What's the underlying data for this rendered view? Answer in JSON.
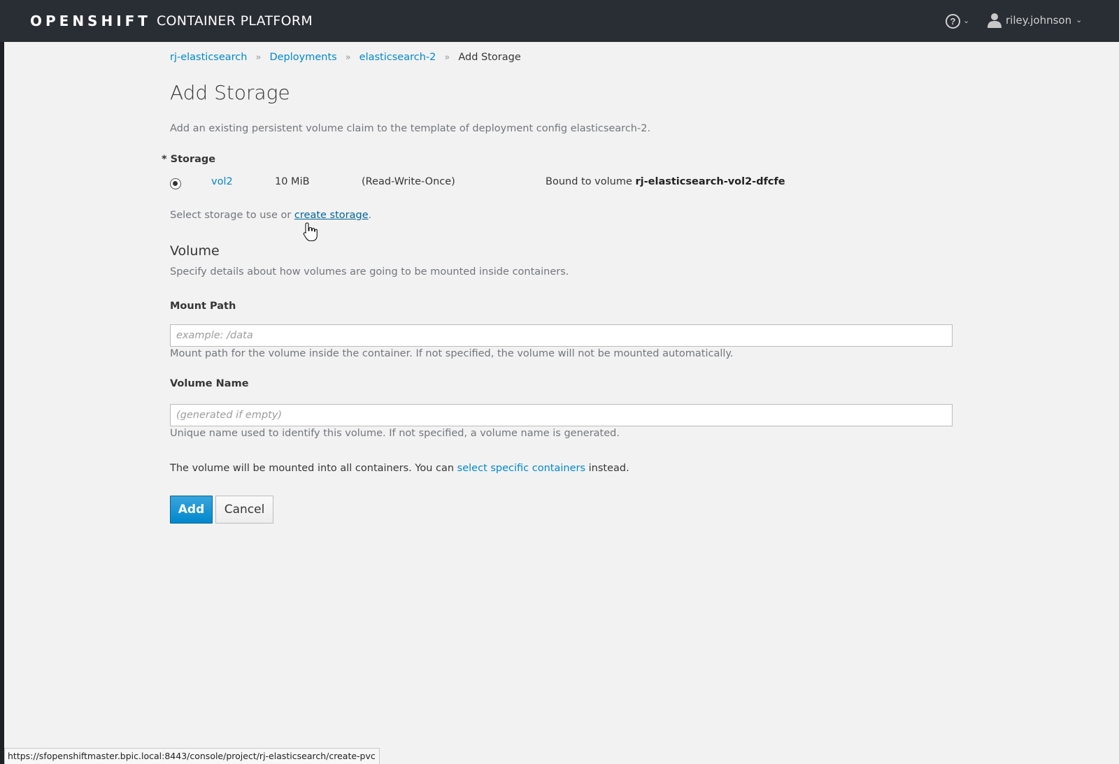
{
  "header": {
    "brand_bold": "OPENSHIFT",
    "brand_light": "CONTAINER PLATFORM",
    "help_icon": "help-circle-icon",
    "user_name": "riley.johnson"
  },
  "breadcrumb": {
    "items": [
      "rj-elasticsearch",
      "Deployments",
      "elasticsearch-2"
    ],
    "current": "Add Storage",
    "separator": "»"
  },
  "page": {
    "title": "Add Storage",
    "description": "Add an existing persistent volume claim to the template of deployment config elasticsearch-2."
  },
  "storage": {
    "label": "* Storage",
    "option": {
      "name": "vol2",
      "size": "10 MiB",
      "access_mode": "(Read-Write-Once)",
      "bound_prefix": "Bound to volume",
      "bound_volume": "rj-elasticsearch-vol2-dfcfe",
      "selected": true
    },
    "hint_prefix": "Select storage to use or",
    "hint_link": "create storage",
    "hint_suffix": "."
  },
  "volume": {
    "heading": "Volume",
    "description": "Specify details about how volumes are going to be mounted inside containers.",
    "mount_path": {
      "label": "Mount Path",
      "value": "",
      "placeholder": "example: /data",
      "help": "Mount path for the volume inside the container. If not specified, the volume will not be mounted automatically."
    },
    "volume_name": {
      "label": "Volume Name",
      "value": "",
      "placeholder": "(generated if empty)",
      "help": "Unique name used to identify this volume. If not specified, a volume name is generated."
    },
    "mount_note_prefix": "The volume will be mounted into all containers. You can",
    "mount_note_link": "select specific containers",
    "mount_note_suffix": "instead."
  },
  "actions": {
    "add_label": "Add",
    "cancel_label": "Cancel"
  },
  "status_bar": {
    "url": "https://sfopenshiftmaster.bpic.local:8443/console/project/rj-elasticsearch/create-pvc"
  },
  "colors": {
    "topbar": "#292e34",
    "link": "#0088ce",
    "primary_button": "#0088ce",
    "background": "#f2f2f2"
  }
}
